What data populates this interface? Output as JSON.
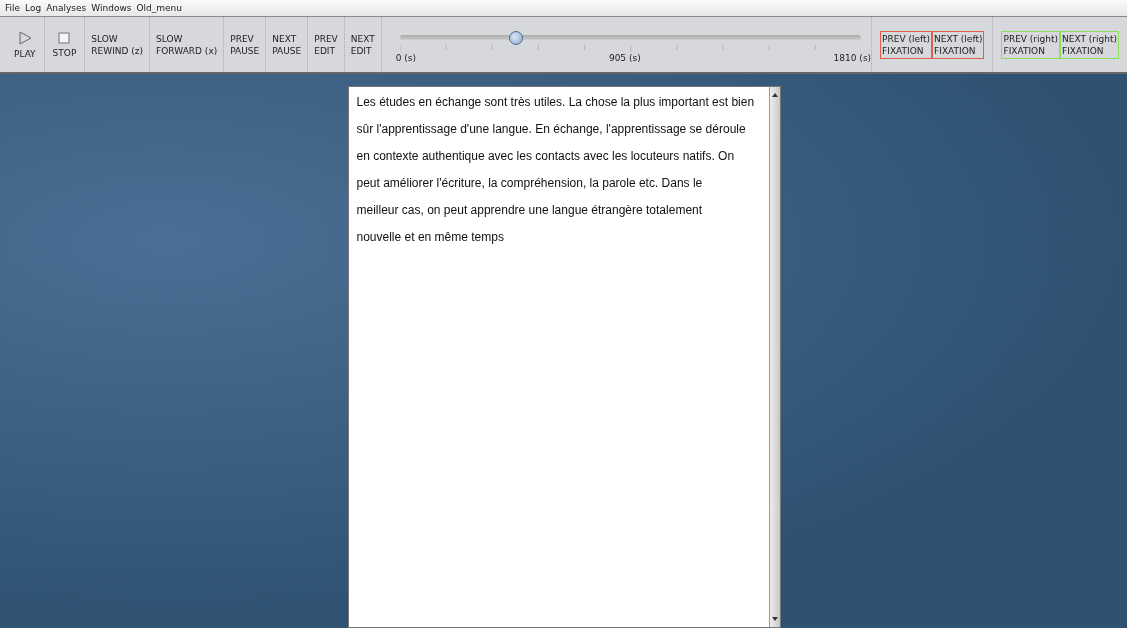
{
  "menu": [
    "File",
    "Log",
    "Analyses",
    "Windows",
    "Old_menu"
  ],
  "toolbar": [
    {
      "kind": "play",
      "label": "PLAY"
    },
    {
      "kind": "stop",
      "label": "STOP"
    },
    {
      "kind": "text",
      "lines": [
        "SLOW",
        "REWIND (z)"
      ]
    },
    {
      "kind": "text",
      "lines": [
        "SLOW",
        "FORWARD (x)"
      ]
    },
    {
      "kind": "text",
      "lines": [
        "PREV",
        "PAUSE"
      ]
    },
    {
      "kind": "text",
      "lines": [
        "NEXT",
        "PAUSE"
      ]
    },
    {
      "kind": "text",
      "lines": [
        "PREV",
        "EDIT"
      ]
    },
    {
      "kind": "text",
      "lines": [
        "NEXT",
        "EDIT"
      ]
    }
  ],
  "timeline": {
    "level": 0.245,
    "labels": [
      "0 (s)",
      "905 (s)",
      "1810 (s)"
    ]
  },
  "fixation_groups": [
    [
      {
        "lines": [
          "PREV (left)",
          "FIXATION"
        ],
        "color": "#e0604e"
      },
      {
        "lines": [
          "NEXT (left)",
          "FIXATION"
        ],
        "color": "#e0604e"
      }
    ],
    [
      {
        "lines": [
          "PREV (right)",
          "FIXATION"
        ],
        "color": "#8ee05a"
      },
      {
        "lines": [
          "NEXT (right)",
          "FIXATION"
        ],
        "color": "#8ee05a"
      }
    ]
  ],
  "editor": {
    "lines": [
      "Les études en échange sont très utiles. La chose la plus important est bien",
      "sûr l'apprentissage d'une langue. En échange, l'apprentissage se déroule",
      "en contexte authentique avec les contacts avec les locuteurs natifs. On",
      "peut améliorer l'écriture, la compréhension, la parole etc. Dans le",
      "meilleur cas, on peut apprendre une langue étrangère totalement",
      "nouvelle et en même temps"
    ]
  }
}
